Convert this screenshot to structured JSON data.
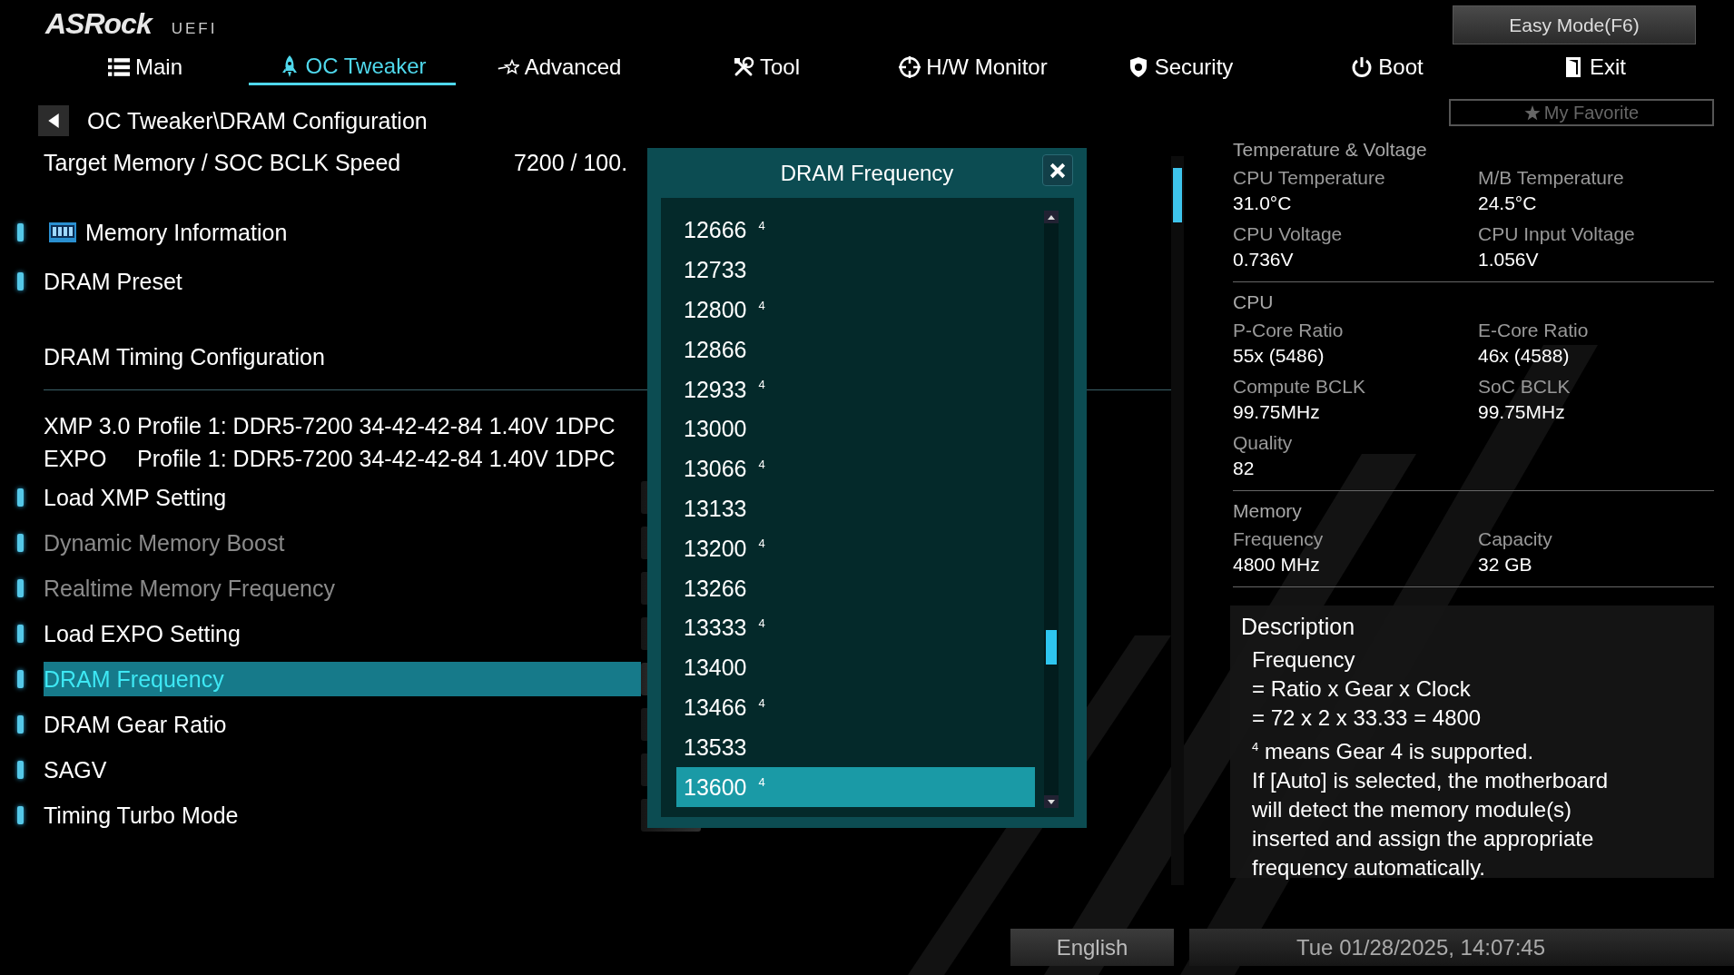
{
  "header": {
    "logo": "ASRock",
    "logo_suffix": "UEFI",
    "easy_mode_button": "Easy Mode(F6)"
  },
  "tabs": [
    {
      "label": "Main",
      "selected": false
    },
    {
      "label": "OC Tweaker",
      "selected": true
    },
    {
      "label": "Advanced",
      "selected": false
    },
    {
      "label": "Tool",
      "selected": false
    },
    {
      "label": "H/W Monitor",
      "selected": false
    },
    {
      "label": "Security",
      "selected": false
    },
    {
      "label": "Boot",
      "selected": false
    },
    {
      "label": "Exit",
      "selected": false
    }
  ],
  "breadcrumb": "OC Tweaker\\DRAM Configuration",
  "target_memory": {
    "label": "Target Memory / SOC BCLK Speed",
    "value": "7200 / 100."
  },
  "menu": [
    {
      "kind": "link_icon",
      "label": "Memory Information",
      "disabled": false,
      "selected": false
    },
    {
      "kind": "link",
      "label": "DRAM Preset",
      "disabled": false,
      "selected": false
    },
    {
      "kind": "heading",
      "label": "DRAM Timing Configuration"
    },
    {
      "kind": "info",
      "name": "XMP 3.0",
      "label": "Profile 1: DDR5-7200 34-42-42-84 1.40V 1DPC"
    },
    {
      "kind": "info",
      "name": "EXPO",
      "label": "Profile 1: DDR5-7200 34-42-42-84 1.40V 1DPC"
    },
    {
      "kind": "option",
      "label": "Load XMP Setting",
      "disabled": false,
      "selected": false
    },
    {
      "kind": "option",
      "label": "Dynamic Memory Boost",
      "disabled": true,
      "selected": false
    },
    {
      "kind": "option",
      "label": "Realtime Memory Frequency",
      "disabled": true,
      "selected": false
    },
    {
      "kind": "option",
      "label": "Load EXPO Setting",
      "disabled": false,
      "selected": false
    },
    {
      "kind": "option",
      "label": "DRAM Frequency",
      "disabled": false,
      "selected": true
    },
    {
      "kind": "option",
      "label": "DRAM Gear Ratio",
      "disabled": false,
      "selected": false
    },
    {
      "kind": "option",
      "label": "SAGV",
      "disabled": false,
      "selected": false
    },
    {
      "kind": "option",
      "label": "Timing Turbo Mode",
      "disabled": false,
      "selected": false
    }
  ],
  "dialog": {
    "title": "DRAM Frequency",
    "options": [
      {
        "label": "12666 $^{4}$",
        "selected": false
      },
      {
        "label": "12733",
        "selected": false
      },
      {
        "label": "12800 $^{4}$",
        "selected": false
      },
      {
        "label": "12866",
        "selected": false
      },
      {
        "label": "12933 $^{4}$",
        "selected": false
      },
      {
        "label": "13000",
        "selected": false
      },
      {
        "label": "13066 $^{4}$",
        "selected": false
      },
      {
        "label": "13133",
        "selected": false
      },
      {
        "label": "13200 $^{4}$",
        "selected": false
      },
      {
        "label": "13266",
        "selected": false
      },
      {
        "label": "13333 $^{4}$",
        "selected": false
      },
      {
        "label": "13400",
        "selected": false
      },
      {
        "label": "13466 $^{4}$",
        "selected": false
      },
      {
        "label": "13533",
        "selected": false
      },
      {
        "label": "13600 $^{4}$",
        "selected": true
      }
    ]
  },
  "favorite_button": "My Favorite",
  "info_panel": [
    {
      "title": "Temperature & Voltage",
      "fields": [
        {
          "label": "CPU Temperature",
          "value": "31.0°C"
        },
        {
          "label": "M/B Temperature",
          "value": "24.5°C"
        },
        {
          "label": "CPU Voltage",
          "value": "0.736V"
        },
        {
          "label": "CPU Input Voltage",
          "value": "1.056V"
        }
      ]
    },
    {
      "title": "CPU",
      "fields": [
        {
          "label": "P-Core Ratio",
          "value": "55x (5486)"
        },
        {
          "label": "E-Core Ratio",
          "value": "46x (4588)"
        },
        {
          "label": "Compute BCLK",
          "value": "99.75MHz"
        },
        {
          "label": "SoC BCLK",
          "value": "99.75MHz"
        },
        {
          "label": "Quality",
          "value": "82"
        }
      ]
    },
    {
      "title": "Memory",
      "fields": [
        {
          "label": "Frequency",
          "value": "4800 MHz"
        },
        {
          "label": "Capacity",
          "value": "32 GB"
        }
      ]
    }
  ],
  "description": {
    "title": "Description",
    "lines": [
      "Frequency",
      "= Ratio x Gear x Clock",
      "= 72 x 2 x 33.33 = 4800",
      "$^{4}$ means Gear 4 is supported.",
      "If [Auto] is selected, the motherboard",
      "will detect the memory module(s)",
      "inserted and assign the appropriate",
      "frequency automatically."
    ]
  },
  "footer": {
    "language_button": "English",
    "datetime": "Tue 01/28/2025, 14:07:45"
  }
}
